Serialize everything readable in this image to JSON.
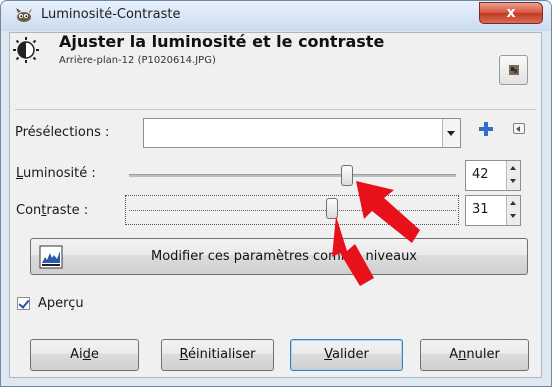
{
  "window": {
    "title": "Luminosité-Contraste",
    "close_label": "x"
  },
  "header": {
    "title": "Ajuster la luminosité et le contraste",
    "subtitle": "Arrière-plan-12 (P1020614.JPG)"
  },
  "presets": {
    "label": "Présélections :",
    "value": ""
  },
  "brightness": {
    "label_prefix": "L",
    "label_rest": "uminosité :",
    "value": "42",
    "level": 42,
    "min": -127,
    "max": 127
  },
  "contrast": {
    "label_prefix": "Con",
    "label_mnemonic": "t",
    "label_rest": "raste :",
    "value": "31",
    "level": 31,
    "min": -127,
    "max": 127
  },
  "levels_button": {
    "label": "Modifier ces paramètres comme niveaux"
  },
  "preview": {
    "label": "Aperçu",
    "checked": true
  },
  "buttons": {
    "help_a": "Ai",
    "help_m": "d",
    "help_b": "e",
    "reset_m": "R",
    "reset_b": "éinitialiser",
    "ok_m": "V",
    "ok_b": "alider",
    "cancel_a": "A",
    "cancel_m": "n",
    "cancel_b": "nuler"
  },
  "icons": {
    "app": "gimp-wilber-icon",
    "header": "brightness-contrast-icon",
    "thumb": "image-thumbnail-icon",
    "add": "add-preset-icon",
    "menu": "preset-menu-icon",
    "levels": "levels-icon"
  },
  "colors": {
    "accent_red": "#e8101a",
    "focus_blue": "#3c7fb1",
    "add_blue": "#2f6fc7"
  }
}
